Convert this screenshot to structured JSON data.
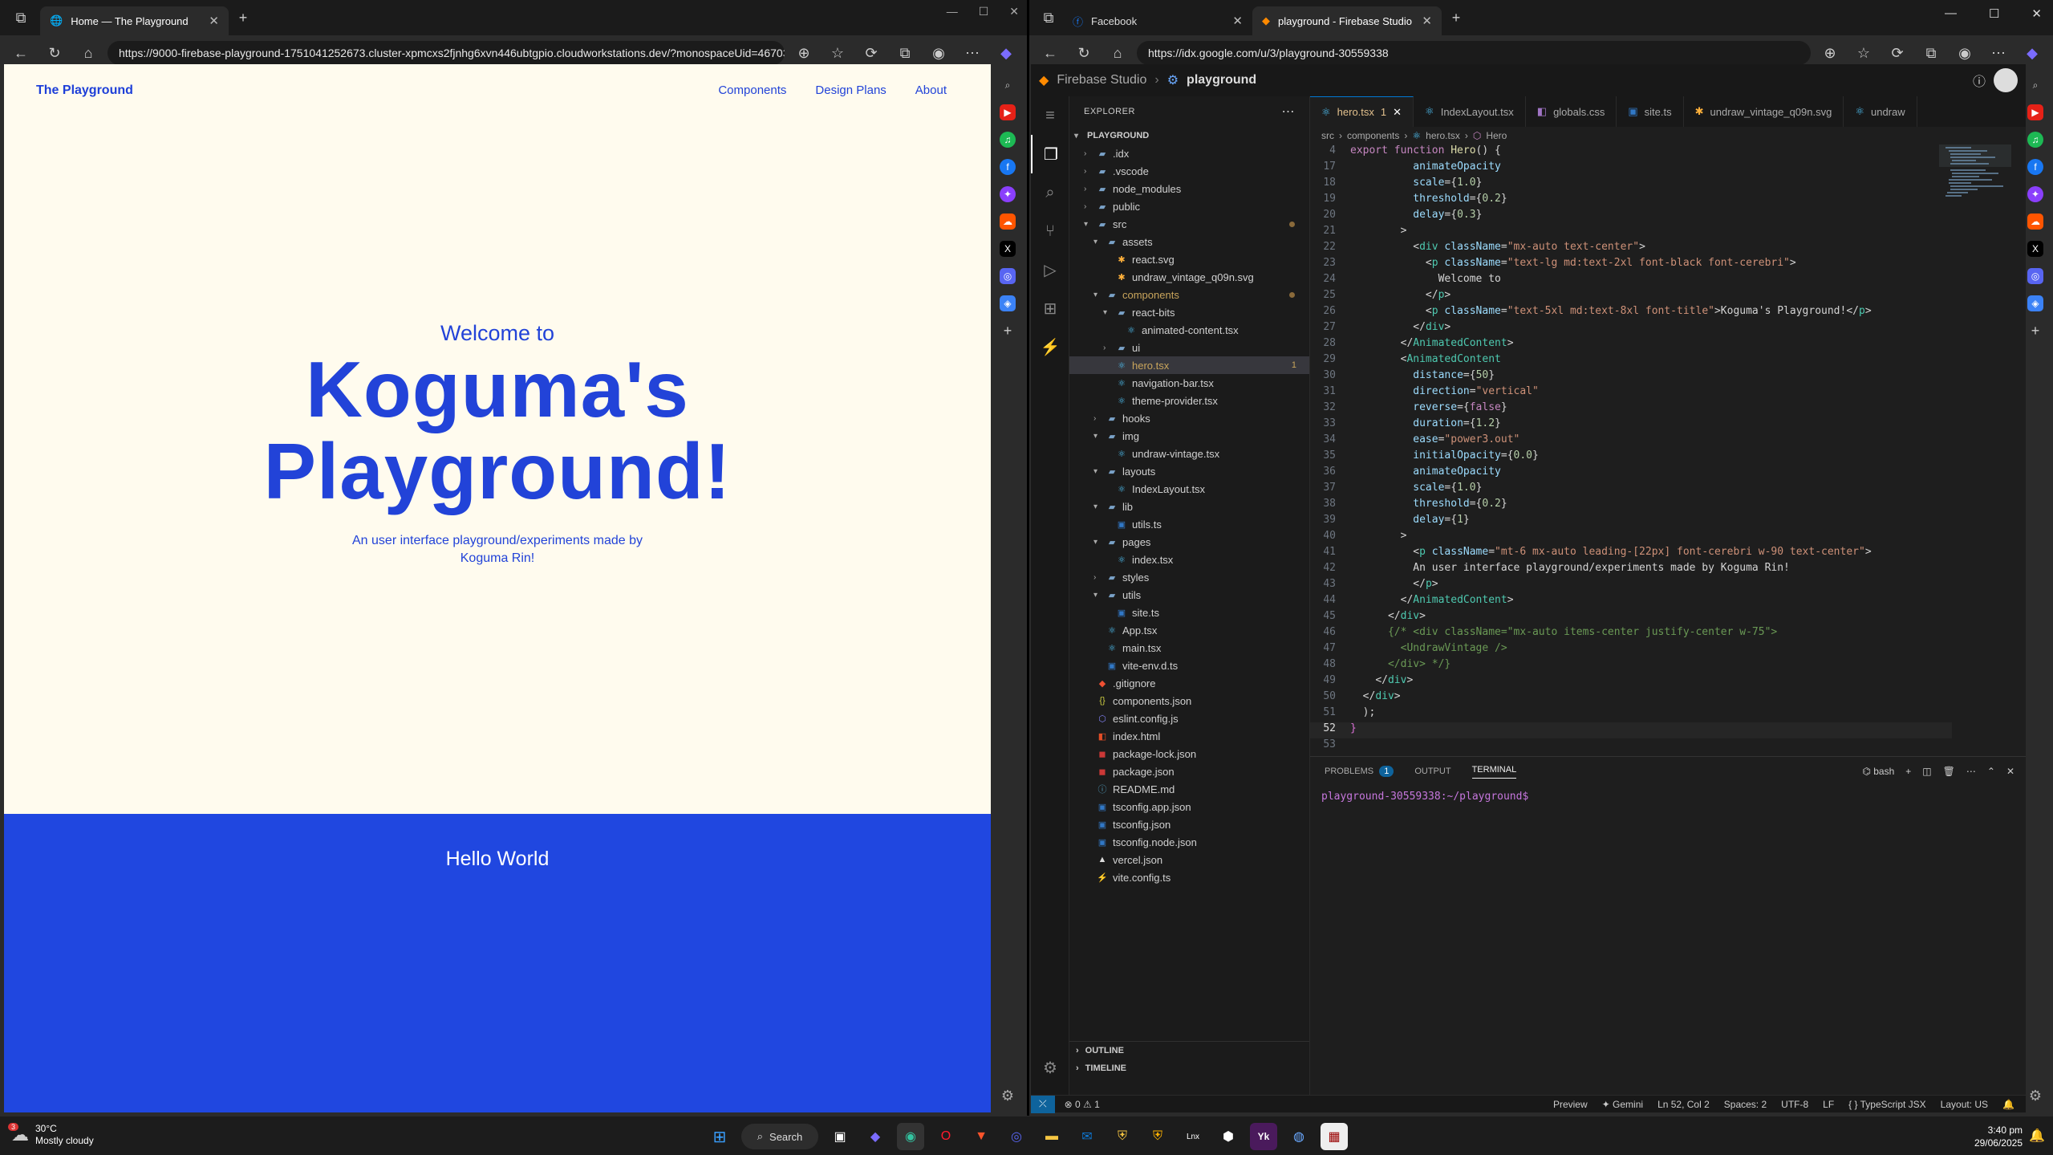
{
  "left_browser": {
    "tab_title": "Home — The Playground",
    "url": "https://9000-firebase-playground-1751041252673.cluster-xpmcxs2fjnhg6xvn446ubtgpio.cloudworkstations.dev/?monospaceUid=467039...",
    "page": {
      "brand": "The Playground",
      "nav": [
        "Components",
        "Design Plans",
        "About"
      ],
      "welcome": "Welcome to",
      "title_line1": "Koguma's",
      "title_line2": "Playground!",
      "subtitle": "An user interface playground/experiments made by Koguma Rin!",
      "section_heading": "Hello World"
    }
  },
  "right_browser": {
    "tabs": [
      "Facebook",
      "playground - Firebase Studio"
    ],
    "url": "https://idx.google.com/u/3/playground-30559338"
  },
  "ide": {
    "product": "Firebase Studio",
    "workspace": "playground",
    "explorer_title": "EXPLORER",
    "root": "PLAYGROUND",
    "tree": [
      {
        "name": ".idx",
        "depth": 1,
        "type": "folder",
        "open": false,
        "icon": "idx-folder-icon"
      },
      {
        "name": ".vscode",
        "depth": 1,
        "type": "folder",
        "open": false,
        "icon": "vscode-folder-icon"
      },
      {
        "name": "node_modules",
        "depth": 1,
        "type": "folder",
        "open": false,
        "icon": "node-folder-icon"
      },
      {
        "name": "public",
        "depth": 1,
        "type": "folder",
        "open": false,
        "icon": "public-folder-icon"
      },
      {
        "name": "src",
        "depth": 1,
        "type": "folder",
        "open": true,
        "icon": "src-folder-icon",
        "dot": true
      },
      {
        "name": "assets",
        "depth": 2,
        "type": "folder",
        "open": true,
        "icon": "assets-folder-icon"
      },
      {
        "name": "react.svg",
        "depth": 3,
        "type": "file",
        "icon": "svg-icon"
      },
      {
        "name": "undraw_vintage_q09n.svg",
        "depth": 3,
        "type": "file",
        "icon": "svg-icon"
      },
      {
        "name": "components",
        "depth": 2,
        "type": "folder",
        "open": true,
        "icon": "components-folder-icon",
        "dot": true,
        "color": "#c9a55c"
      },
      {
        "name": "react-bits",
        "depth": 3,
        "type": "folder",
        "open": true,
        "icon": "folder-icon"
      },
      {
        "name": "animated-content.tsx",
        "depth": 4,
        "type": "file",
        "icon": "react-icon"
      },
      {
        "name": "ui",
        "depth": 3,
        "type": "folder",
        "open": false,
        "icon": "folder-icon"
      },
      {
        "name": "hero.tsx",
        "depth": 3,
        "type": "file",
        "icon": "react-icon",
        "selected": true,
        "badge": "1",
        "color": "#c9a55c"
      },
      {
        "name": "navigation-bar.tsx",
        "depth": 3,
        "type": "file",
        "icon": "react-icon"
      },
      {
        "name": "theme-provider.tsx",
        "depth": 3,
        "type": "file",
        "icon": "react-icon"
      },
      {
        "name": "hooks",
        "depth": 2,
        "type": "folder",
        "open": false,
        "icon": "hooks-folder-icon"
      },
      {
        "name": "img",
        "depth": 2,
        "type": "folder",
        "open": true,
        "icon": "img-folder-icon"
      },
      {
        "name": "undraw-vintage.tsx",
        "depth": 3,
        "type": "file",
        "icon": "react-icon"
      },
      {
        "name": "layouts",
        "depth": 2,
        "type": "folder",
        "open": true,
        "icon": "layouts-folder-icon"
      },
      {
        "name": "IndexLayout.tsx",
        "depth": 3,
        "type": "file",
        "icon": "react-icon"
      },
      {
        "name": "lib",
        "depth": 2,
        "type": "folder",
        "open": true,
        "icon": "lib-folder-icon"
      },
      {
        "name": "utils.ts",
        "depth": 3,
        "type": "file",
        "icon": "ts-icon"
      },
      {
        "name": "pages",
        "depth": 2,
        "type": "folder",
        "open": true,
        "icon": "pages-folder-icon"
      },
      {
        "name": "index.tsx",
        "depth": 3,
        "type": "file",
        "icon": "react-icon"
      },
      {
        "name": "styles",
        "depth": 2,
        "type": "folder",
        "open": false,
        "icon": "styles-folder-icon"
      },
      {
        "name": "utils",
        "depth": 2,
        "type": "folder",
        "open": true,
        "icon": "utils-folder-icon"
      },
      {
        "name": "site.ts",
        "depth": 3,
        "type": "file",
        "icon": "ts-icon"
      },
      {
        "name": "App.tsx",
        "depth": 2,
        "type": "file",
        "icon": "react-icon"
      },
      {
        "name": "main.tsx",
        "depth": 2,
        "type": "file",
        "icon": "react-icon"
      },
      {
        "name": "vite-env.d.ts",
        "depth": 2,
        "type": "file",
        "icon": "ts-icon"
      },
      {
        "name": ".gitignore",
        "depth": 1,
        "type": "file",
        "icon": "git-icon"
      },
      {
        "name": "components.json",
        "depth": 1,
        "type": "file",
        "icon": "json-icon"
      },
      {
        "name": "eslint.config.js",
        "depth": 1,
        "type": "file",
        "icon": "eslint-icon"
      },
      {
        "name": "index.html",
        "depth": 1,
        "type": "file",
        "icon": "html-icon"
      },
      {
        "name": "package-lock.json",
        "depth": 1,
        "type": "file",
        "icon": "npm-icon"
      },
      {
        "name": "package.json",
        "depth": 1,
        "type": "file",
        "icon": "npm-icon"
      },
      {
        "name": "README.md",
        "depth": 1,
        "type": "file",
        "icon": "info-icon"
      },
      {
        "name": "tsconfig.app.json",
        "depth": 1,
        "type": "file",
        "icon": "tsconfig-icon"
      },
      {
        "name": "tsconfig.json",
        "depth": 1,
        "type": "file",
        "icon": "tsconfig-icon"
      },
      {
        "name": "tsconfig.node.json",
        "depth": 1,
        "type": "file",
        "icon": "tsconfig-icon"
      },
      {
        "name": "vercel.json",
        "depth": 1,
        "type": "file",
        "icon": "vercel-icon"
      },
      {
        "name": "vite.config.ts",
        "depth": 1,
        "type": "file",
        "icon": "vite-icon"
      }
    ],
    "editor_tabs": [
      {
        "name": "hero.tsx",
        "badge": "1",
        "active": true
      },
      {
        "name": "IndexLayout.tsx"
      },
      {
        "name": "globals.css"
      },
      {
        "name": "site.ts"
      },
      {
        "name": "undraw_vintage_q09n.svg"
      },
      {
        "name": "undraw"
      }
    ],
    "breadcrumb": [
      "src",
      "components",
      "hero.tsx",
      "Hero"
    ],
    "sticky_line": {
      "n": "4",
      "html": "<span class='kw'>export function </span><span class='fn'>Hero</span><span class='p'>() {</span>"
    },
    "code_lines": [
      {
        "n": "17",
        "html": "          <span class='at'>animateOpacity</span>"
      },
      {
        "n": "18",
        "html": "          <span class='at'>scale</span><span class='p'>={</span><span class='nu'>1.0</span><span class='p'>}</span>"
      },
      {
        "n": "19",
        "html": "          <span class='at'>threshold</span><span class='p'>={</span><span class='nu'>0.2</span><span class='p'>}</span>"
      },
      {
        "n": "20",
        "html": "          <span class='at'>delay</span><span class='p'>={</span><span class='nu'>0.3</span><span class='p'>}</span>"
      },
      {
        "n": "21",
        "html": "        <span class='p'>&gt;</span>"
      },
      {
        "n": "22",
        "html": "          <span class='p'>&lt;</span><span class='tg'>div</span> <span class='at'>className</span><span class='p'>=</span><span class='st'>\"mx-auto text-center\"</span><span class='p'>&gt;</span>"
      },
      {
        "n": "23",
        "html": "            <span class='p'>&lt;</span><span class='tg'>p</span> <span class='at'>className</span><span class='p'>=</span><span class='st'>\"text-lg md:text-2xl font-black font-cerebri\"</span><span class='p'>&gt;</span>"
      },
      {
        "n": "24",
        "html": "              <span class='p'>Welcome to</span>"
      },
      {
        "n": "25",
        "html": "            <span class='p'>&lt;/</span><span class='tg'>p</span><span class='p'>&gt;</span>"
      },
      {
        "n": "26",
        "html": "            <span class='p'>&lt;</span><span class='tg'>p</span> <span class='at'>className</span><span class='p'>=</span><span class='st'>\"text-5xl md:text-8xl font-title\"</span><span class='p'>&gt;Koguma's Playground!&lt;/</span><span class='tg'>p</span><span class='p'>&gt;</span>"
      },
      {
        "n": "27",
        "html": "          <span class='p'>&lt;/</span><span class='tg'>div</span><span class='p'>&gt;</span>"
      },
      {
        "n": "28",
        "html": "        <span class='p'>&lt;/</span><span class='tg'>AnimatedContent</span><span class='p'>&gt;</span>"
      },
      {
        "n": "29",
        "html": "        <span class='p'>&lt;</span><span class='tg'>AnimatedContent</span>"
      },
      {
        "n": "30",
        "html": "          <span class='at'>distance</span><span class='p'>={</span><span class='nu'>50</span><span class='p'>}</span>"
      },
      {
        "n": "31",
        "html": "          <span class='at'>direction</span><span class='p'>=</span><span class='st'>\"vertical\"</span>"
      },
      {
        "n": "32",
        "html": "          <span class='at'>reverse</span><span class='p'>={</span><span class='kw'>false</span><span class='p'>}</span>"
      },
      {
        "n": "33",
        "html": "          <span class='at'>duration</span><span class='p'>={</span><span class='nu'>1.2</span><span class='p'>}</span>"
      },
      {
        "n": "34",
        "html": "          <span class='at'>ease</span><span class='p'>=</span><span class='st'>\"power3.out\"</span>"
      },
      {
        "n": "35",
        "html": "          <span class='at'>initialOpacity</span><span class='p'>={</span><span class='nu'>0.0</span><span class='p'>}</span>"
      },
      {
        "n": "36",
        "html": "          <span class='at'>animateOpacity</span>"
      },
      {
        "n": "37",
        "html": "          <span class='at'>scale</span><span class='p'>={</span><span class='nu'>1.0</span><span class='p'>}</span>"
      },
      {
        "n": "38",
        "html": "          <span class='at'>threshold</span><span class='p'>={</span><span class='nu'>0.2</span><span class='p'>}</span>"
      },
      {
        "n": "39",
        "html": "          <span class='at'>delay</span><span class='p'>={</span><span class='nu'>1</span><span class='p'>}</span>"
      },
      {
        "n": "40",
        "html": "        <span class='p'>&gt;</span>"
      },
      {
        "n": "41",
        "html": "          <span class='p'>&lt;</span><span class='tg'>p</span> <span class='at'>className</span><span class='p'>=</span><span class='st'>\"mt-6 mx-auto leading-[22px] font-cerebri w-90 text-center\"</span><span class='p'>&gt;</span>"
      },
      {
        "n": "42",
        "html": "          <span class='p'>An user interface playground/experiments made by Koguma Rin!</span>"
      },
      {
        "n": "43",
        "html": "          <span class='p'>&lt;/</span><span class='tg'>p</span><span class='p'>&gt;</span>"
      },
      {
        "n": "44",
        "html": "        <span class='p'>&lt;/</span><span class='tg'>AnimatedContent</span><span class='p'>&gt;</span>"
      },
      {
        "n": "45",
        "html": "      <span class='p'>&lt;/</span><span class='tg'>div</span><span class='p'>&gt;</span>"
      },
      {
        "n": "46",
        "html": "      <span class='cm'>{/* &lt;div className=\"mx-auto items-center justify-center w-75\"&gt;</span>"
      },
      {
        "n": "47",
        "html": "        <span class='cm'>&lt;UndrawVintage /&gt;</span>"
      },
      {
        "n": "48",
        "html": "      <span class='cm'>&lt;/div&gt; */}</span>"
      },
      {
        "n": "49",
        "html": "    <span class='p'>&lt;/</span><span class='tg'>div</span><span class='p'>&gt;</span>"
      },
      {
        "n": "50",
        "html": "  <span class='p'>&lt;/</span><span class='tg'>div</span><span class='p'>&gt;</span>"
      },
      {
        "n": "51",
        "html": "  <span class='p'>);</span>"
      },
      {
        "n": "52",
        "html": "<span class='br'>}</span>",
        "current": true
      },
      {
        "n": "53",
        "html": ""
      }
    ],
    "panel_tabs": [
      "PROBLEMS",
      "OUTPUT",
      "TERMINAL"
    ],
    "problems_count": "1",
    "terminal_shell": "bash",
    "terminal_prompt": "playground-30559338:~/playground$",
    "status_left": {
      "errors": "0",
      "warnings": "1"
    },
    "status_right": [
      "Preview",
      "Gemini",
      "Ln 52, Col 2",
      "Spaces: 2",
      "UTF-8",
      "LF",
      "TypeScript JSX",
      "Layout: US"
    ]
  },
  "taskbar": {
    "weather_temp": "30°C",
    "weather_desc": "Mostly cloudy",
    "weather_badge": "3",
    "search_label": "Search",
    "time": "3:40 pm",
    "date": "29/06/2025"
  },
  "colors": {
    "page_bg": "#fffbee",
    "brand_blue": "#2047e0",
    "ide_bg": "#1e1e1e"
  }
}
